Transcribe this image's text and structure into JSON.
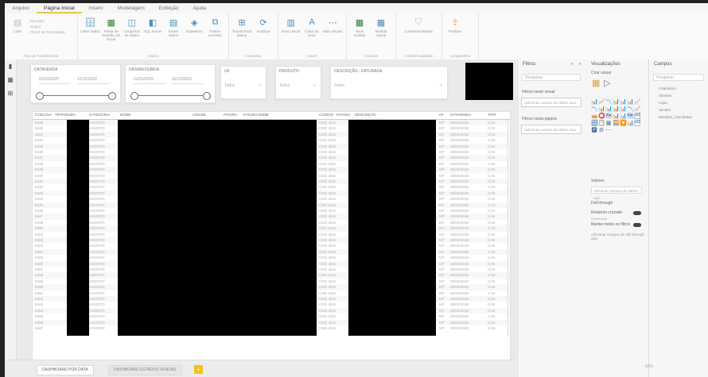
{
  "menu": {
    "tabs": [
      "Arquivo",
      "Página Inicial",
      "Inserir",
      "Modelagem",
      "Exibição",
      "Ajuda"
    ],
    "active_index": 1
  },
  "ribbon": {
    "clipboard": {
      "items": [
        "Colar",
        "Recortar",
        "Copiar",
        "Pincel de Formatação"
      ],
      "name": "Área de Transferência"
    },
    "groups": [
      {
        "name": "Dados",
        "buttons": [
          "Obter dados",
          "Pasta de trabalho do Excel",
          "Conjuntos de dados",
          "SQL Server",
          "Inserir dados",
          "Dataverse",
          "Fontes recentes"
        ]
      },
      {
        "name": "Consultas",
        "buttons": [
          "Transformar dados",
          "Atualizar"
        ]
      },
      {
        "name": "Inserir",
        "buttons": [
          "Novo visual",
          "Caixa de texto",
          "Mais visuais"
        ]
      },
      {
        "name": "Cálculos",
        "buttons": [
          "Nova medida",
          "Medida rápida"
        ]
      },
      {
        "name": "Confidencialidade",
        "buttons": [
          "Confidencialidade"
        ]
      },
      {
        "name": "Compartilhar",
        "buttons": [
          "Publicar"
        ]
      }
    ]
  },
  "left_rail": [
    "report-view-icon",
    "data-view-icon",
    "model-view-icon"
  ],
  "slicers": {
    "date1": {
      "title": "DATAVENDA",
      "from": "01/01/2020",
      "to": "31/12/2022"
    },
    "date2": {
      "title": "DATARECEBIDA",
      "from": "01/01/2020",
      "to": "31/12/2022"
    },
    "dd1": {
      "title": "UF",
      "value": "Todos"
    },
    "dd2": {
      "title": "PRODUTO",
      "value": "Todos"
    },
    "dd3": {
      "title": "DESCRIÇÃO - FATURADA",
      "value": "Todos"
    }
  },
  "table": {
    "columns": [
      "CODLOJA",
      "TIPOVENDA",
      "CATEGORIA",
      "NOME",
      "CIDADE",
      "FATURA",
      "FATURA NOME",
      "CODIGO",
      "FATURA",
      "DESCRIÇÃO",
      "UF",
      "DATAVENDA",
      "TIPO"
    ],
    "rows": [
      [
        "5449",
        "AGOSTO",
        "CDG 4011",
        "MT",
        "20/04/2018",
        "CAS"
      ],
      [
        "5430",
        "AGOSTO",
        "CDG 4011",
        "MT",
        "20/04/2018",
        "CAS"
      ],
      [
        "1123",
        "AGOSTO",
        "CDG 4011",
        "MT",
        "20/04/2018",
        "CAS"
      ],
      [
        "5432",
        "AGOSTO",
        "CDG 4011",
        "MT",
        "20/04/2018",
        "CAS"
      ],
      [
        "5490",
        "AGOSTO",
        "CDG 4011",
        "MT",
        "20/04/2018",
        "CAS"
      ],
      [
        "5436",
        "AGOSTO",
        "CDG 4011",
        "MT",
        "20/04/2018",
        "CAS"
      ],
      [
        "5437",
        "AGOSTO",
        "CDG 4011",
        "MT",
        "20/04/2018",
        "CAS"
      ],
      [
        "5438",
        "AGOSTO",
        "CDG 4011",
        "MT",
        "20/04/2018",
        "CAS"
      ],
      [
        "5439",
        "AGOSTO",
        "CDG 4011",
        "MT",
        "20/04/2018",
        "CAS"
      ],
      [
        "5440",
        "AGOSTO",
        "CDG 4011",
        "MT",
        "20/04/2018",
        "CAS"
      ],
      [
        "5441",
        "AGOSTO",
        "CDG 4011",
        "MT",
        "20/04/2018",
        "CAS"
      ],
      [
        "5442",
        "AGOSTO",
        "CDG 4011",
        "MT",
        "20/04/2018",
        "CAS"
      ],
      [
        "5443",
        "AGOSTO",
        "CDG 4011",
        "MT",
        "20/04/2018",
        "CAS"
      ],
      [
        "5444",
        "AGOSTO",
        "CDG 4011",
        "MT",
        "20/04/2018",
        "CAS"
      ],
      [
        "5445",
        "AGOSTO",
        "CDG 4011",
        "MT",
        "20/04/2018",
        "CAS"
      ],
      [
        "5446",
        "AGOSTO",
        "CDG 4011",
        "MT",
        "20/04/2018",
        "CAS"
      ],
      [
        "5447",
        "AGOSTO",
        "CDG 4011",
        "MT",
        "20/04/2018",
        "CAS"
      ],
      [
        "5448",
        "AGOSTO",
        "CDG 4011",
        "MT",
        "20/04/2018",
        "CAS"
      ],
      [
        "5450",
        "AGOSTO",
        "CDG 4011",
        "MT",
        "20/04/2018",
        "CAS"
      ],
      [
        "5451",
        "AGOSTO",
        "CDG 4011",
        "MT",
        "20/04/2018",
        "CAS"
      ],
      [
        "5452",
        "AGOSTO",
        "CDG 4011",
        "MT",
        "20/04/2018",
        "CAS"
      ],
      [
        "5453",
        "AGOSTO",
        "CDG 4011",
        "MT",
        "20/04/2018",
        "CAS"
      ],
      [
        "5454",
        "AGOSTO",
        "CDG 4011",
        "MT",
        "20/04/2018",
        "CAS"
      ],
      [
        "5455",
        "AGOSTO",
        "CDG 4011",
        "MT",
        "20/04/2018",
        "CAS"
      ],
      [
        "5456",
        "AGOSTO",
        "CDG 4011",
        "MT",
        "20/04/2018",
        "CAS"
      ],
      [
        "5457",
        "AGOSTO",
        "CDG 4011",
        "MT",
        "20/04/2018",
        "CAS"
      ],
      [
        "5458",
        "AGOSTO",
        "CDG 4011",
        "MT",
        "20/04/2018",
        "CAS"
      ],
      [
        "5459",
        "AGOSTO",
        "CDG 4011",
        "MT",
        "20/04/2018",
        "CAS"
      ],
      [
        "5460",
        "AGOSTO",
        "CDG 4011",
        "MT",
        "20/04/2018",
        "CAS"
      ],
      [
        "5461",
        "AGOSTO",
        "CDG 4011",
        "MT",
        "20/04/2018",
        "CAS"
      ],
      [
        "5462",
        "AGOSTO",
        "CDG 4011",
        "MT",
        "20/04/2018",
        "CAS"
      ],
      [
        "5463",
        "AGOSTO",
        "CDG 4011",
        "MT",
        "20/04/2018",
        "CAS"
      ],
      [
        "5464",
        "AGOSTO",
        "CDG 4011",
        "MT",
        "20/04/2018",
        "CAS"
      ],
      [
        "5465",
        "AGOSTO",
        "CDG 4011",
        "MT",
        "20/04/2018",
        "CAS"
      ],
      [
        "5466",
        "AGOSTO",
        "CDG 4011",
        "MT",
        "20/04/2018",
        "CAS"
      ],
      [
        "5467",
        "AGOSTO",
        "CDG 4011",
        "MT",
        "20/04/2018",
        "CAS"
      ]
    ]
  },
  "page_tabs": {
    "tabs": [
      "DASHBOARD POR DATA",
      "DASHBOARD ESTADOS VENDAS"
    ],
    "add": "+"
  },
  "filters": {
    "title": "Filtros",
    "search_placeholder": "Pesquisar",
    "section_visual": "Filtros neste visual",
    "card_visual": "Adicionar campos de dados aqui",
    "section_page": "Filtros nesta página",
    "card_page": "Adicionar campos de dados aqui",
    "collapse": "«",
    "expand": "»"
  },
  "viz": {
    "title": "Visualizações",
    "build_label": "Criar visual",
    "icons": [
      "📊",
      "📈",
      "📉",
      "📊",
      "📊",
      "📊",
      "📈",
      "📉",
      "📊",
      "📊",
      "📊",
      "📊",
      "📉",
      "📈",
      "🥧",
      "⭕",
      "🗺",
      "📊",
      "📊",
      "🗺",
      "🗂",
      "🔢",
      "📋",
      "▦",
      "🧮",
      "🔽",
      "📊",
      "🗂",
      "🅿",
      "⚙",
      "⋯"
    ],
    "values_label": "Valores",
    "values_placeholder": "Adicionar campos de dados aqui",
    "drill_label": "Drill-through",
    "cross_report": "Relatório cruzado",
    "cross_report_state": "Desativado",
    "keep_filters": "Manter todos os filtros",
    "add_fields": "Adicionar campos de drill-through aqui"
  },
  "fields": {
    "title": "Campos",
    "search_placeholder": "Pesquisar",
    "items": [
      "Calendário",
      "Clientes",
      "Lojas",
      "Vendas",
      "Medidas_Calculadas"
    ]
  },
  "status": {
    "zoom": "80%"
  },
  "colors": {
    "accent": "#e8c34a",
    "add_page": "#f0c419",
    "icon": "#4a90b8"
  }
}
